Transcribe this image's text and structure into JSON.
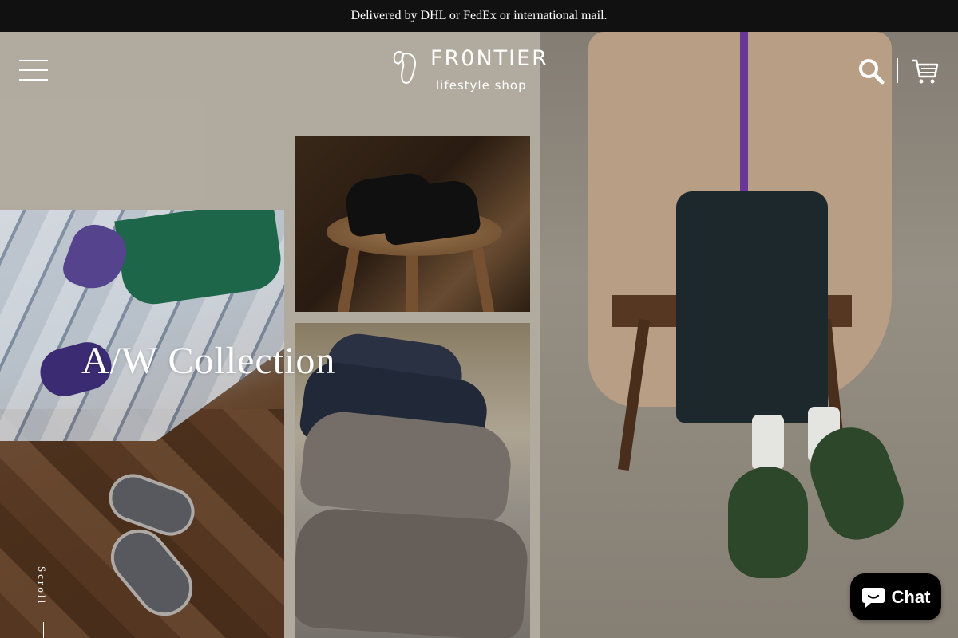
{
  "announcement": "Delivered by DHL or FedEx or international mail.",
  "header": {
    "menu_icon": "hamburger-menu-icon",
    "logo": {
      "name": "FR0NTIER",
      "tagline": "lifestyle shop"
    },
    "search_icon": "search-icon",
    "cart_icon": "cart-icon"
  },
  "hero": {
    "headline": "A/W Collection",
    "scroll_label": "Scroll",
    "slide_count": 10,
    "active_slide": 1
  },
  "chat": {
    "label": "Chat",
    "icon": "chat-bubble-icon"
  },
  "colors": {
    "announcement_bg": "#111111",
    "hero_bg": "#b9b2a6",
    "chat_bg": "#000000",
    "text_light": "#ffffff"
  }
}
